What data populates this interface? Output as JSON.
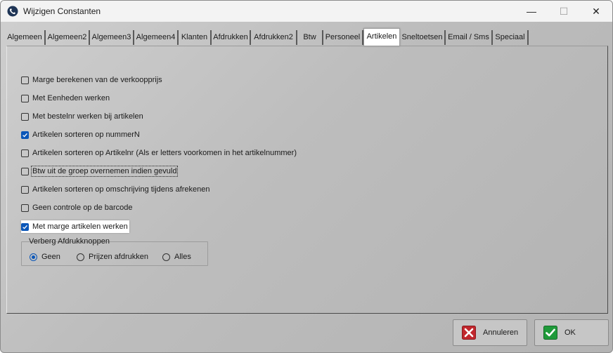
{
  "window": {
    "title": "Wijzigen Constanten"
  },
  "titlebar_buttons": {
    "minimize": "—",
    "maximize": "☐",
    "close": "✕"
  },
  "tabs": [
    {
      "label": "Algemeen"
    },
    {
      "label": "Algemeen2"
    },
    {
      "label": "Algemeen3"
    },
    {
      "label": "Algemeen4"
    },
    {
      "label": "Klanten"
    },
    {
      "label": "Afdrukken"
    },
    {
      "label": "Afdrukken2"
    },
    {
      "label": "Btw"
    },
    {
      "label": "Personeel"
    },
    {
      "label": "Artikelen"
    },
    {
      "label": "Sneltoetsen"
    },
    {
      "label": "Email / Sms"
    },
    {
      "label": "Speciaal"
    }
  ],
  "active_tab": "Artikelen",
  "options": [
    {
      "label": "Marge berekenen van de verkoopprijs",
      "checked": false
    },
    {
      "label": "Met Eenheden werken",
      "checked": false
    },
    {
      "label": "Met bestelnr werken bij artikelen",
      "checked": false
    },
    {
      "label": "Artikelen sorteren op nummerN",
      "checked": true
    },
    {
      "label": "Artikelen sorteren op Artikelnr (Als er letters voorkomen in het artikelnummer)",
      "checked": false
    },
    {
      "label": "Btw uit de groep overnemen indien gevuld",
      "checked": false
    },
    {
      "label": "Artikelen sorteren op omschrijving tijdens afrekenen",
      "checked": false
    },
    {
      "label": "Geen controle op de barcode",
      "checked": false
    },
    {
      "label": "Met marge artikelen werken",
      "checked": true
    }
  ],
  "print_group": {
    "title": "Verberg  Afdrukknoppen",
    "radios": [
      {
        "label": "Geen",
        "checked": true
      },
      {
        "label": "Prijzen afdrukken",
        "checked": false
      },
      {
        "label": "Alles",
        "checked": false
      }
    ]
  },
  "buttons": {
    "cancel": "Annuleren",
    "ok": "OK"
  },
  "colors": {
    "accent": "#0a56b8",
    "cancel_icon": "#c1272d",
    "ok_icon": "#1f9a3a"
  }
}
